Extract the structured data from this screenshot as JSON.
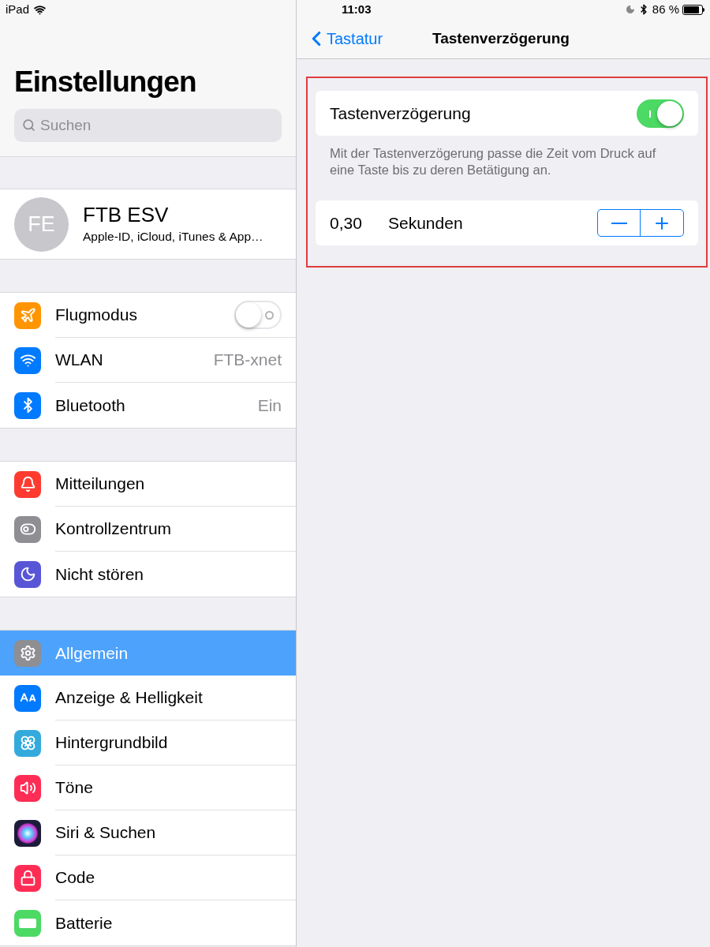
{
  "status_bar": {
    "device": "iPad",
    "time": "11:03",
    "battery": "86 %"
  },
  "sidebar": {
    "title": "Einstellungen",
    "search": {
      "placeholder": "Suchen"
    },
    "profile": {
      "initials": "FE",
      "name": "FTB ESV",
      "subtitle": "Apple-ID, iCloud, iTunes & App…"
    },
    "groups": [
      {
        "items": [
          {
            "kind": "toggle",
            "label": "Flugmodus",
            "on": false,
            "selected": false
          },
          {
            "kind": "value",
            "label": "WLAN",
            "value": "FTB-xnet",
            "selected": false
          },
          {
            "kind": "value",
            "label": "Bluetooth",
            "value": "Ein",
            "selected": false
          }
        ]
      },
      {
        "items": [
          {
            "kind": "plain",
            "label": "Mitteilungen",
            "selected": false
          },
          {
            "kind": "plain",
            "label": "Kontrollzentrum",
            "selected": false
          },
          {
            "kind": "plain",
            "label": "Nicht stören",
            "selected": false
          }
        ]
      },
      {
        "items": [
          {
            "kind": "plain",
            "label": "Allgemein",
            "selected": true
          },
          {
            "kind": "plain",
            "label": "Anzeige & Helligkeit",
            "selected": false
          },
          {
            "kind": "plain",
            "label": "Hintergrundbild",
            "selected": false
          },
          {
            "kind": "plain",
            "label": "Töne",
            "selected": false
          },
          {
            "kind": "plain",
            "label": "Siri & Suchen",
            "selected": false
          },
          {
            "kind": "plain",
            "label": "Code",
            "selected": false
          },
          {
            "kind": "plain",
            "label": "Batterie",
            "selected": false
          }
        ]
      }
    ]
  },
  "detail": {
    "back": "Tastatur",
    "title": "Tastenverzögerung",
    "toggle": {
      "label": "Tastenverzögerung",
      "on": true
    },
    "footer": "Mit der Tastenverzögerung passe die Zeit vom Druck auf eine Taste bis zu deren Betätigung an.",
    "stepper": {
      "value": "0,30",
      "unit": "Sekunden"
    }
  }
}
